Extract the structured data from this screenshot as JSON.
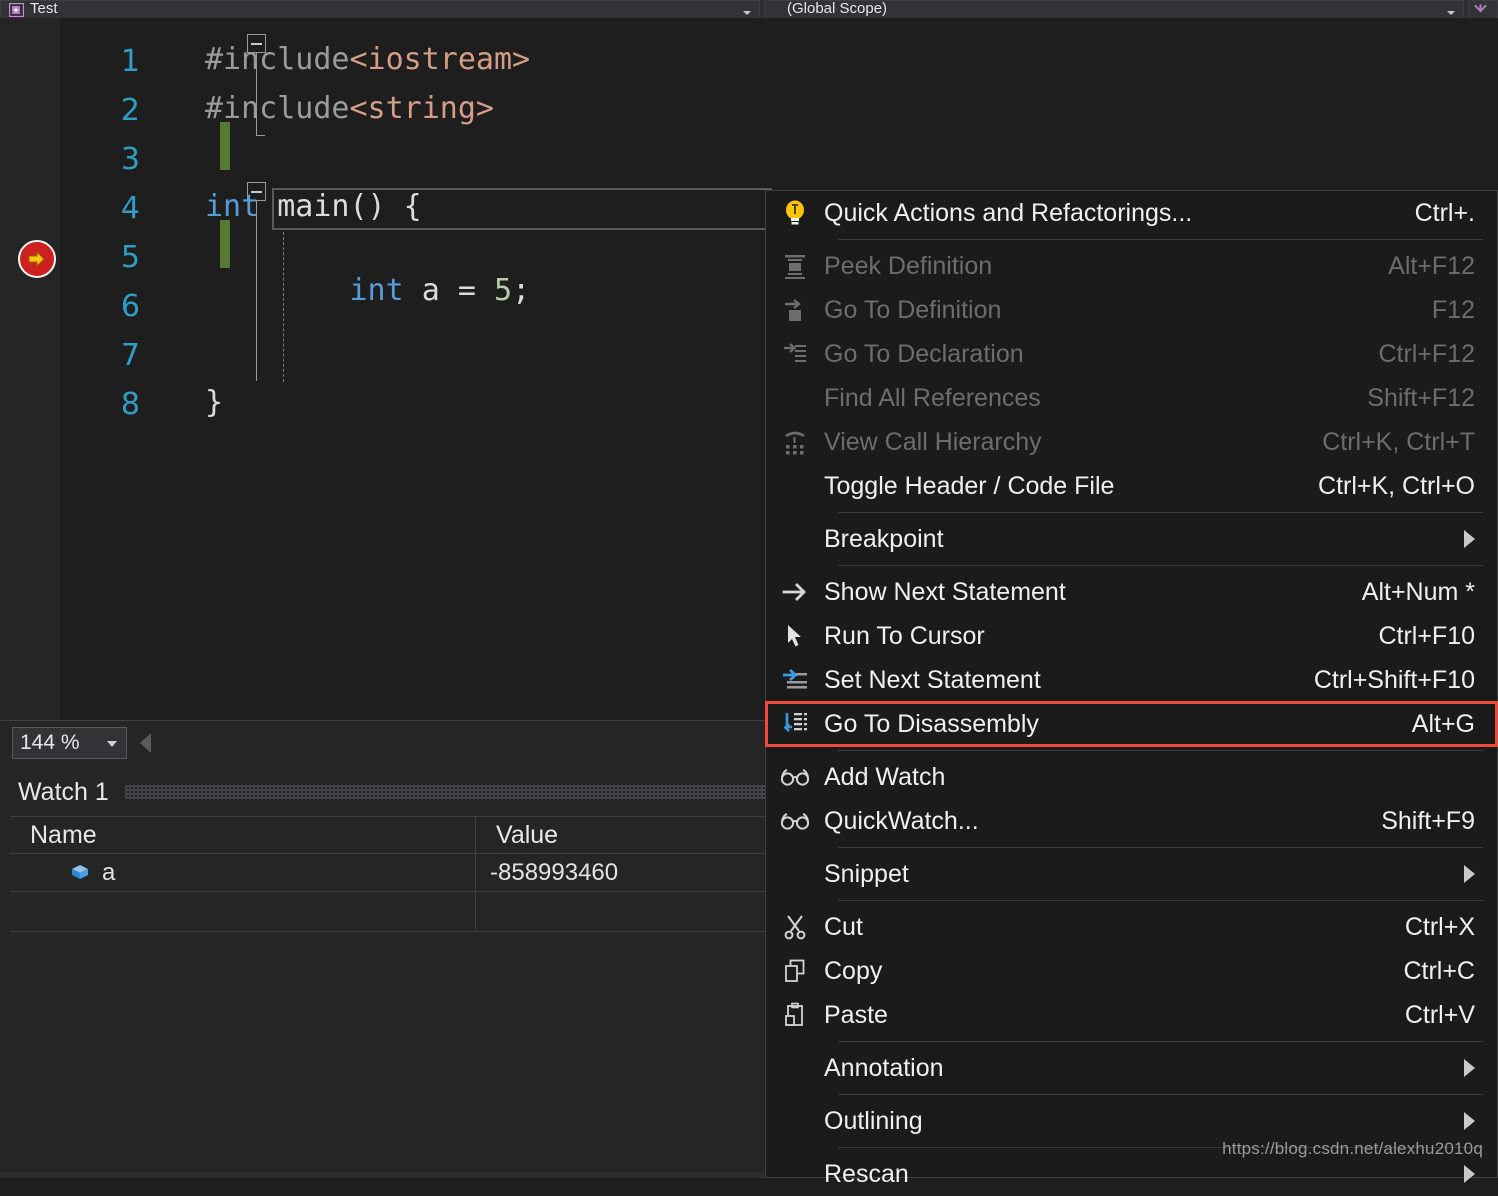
{
  "topbar": {
    "file_tab": "Test",
    "file_tab_icon": "file-cpp-icon",
    "scope": "(Global Scope)",
    "right_icon": "expand-icon"
  },
  "editor": {
    "lines": [
      {
        "number": "1",
        "text": "#include<iostream>"
      },
      {
        "number": "2",
        "text": "#include<string>"
      },
      {
        "number": "3",
        "text": ""
      },
      {
        "number": "4",
        "text": "int main() {"
      },
      {
        "number": "5",
        "text": "    int a = 5;"
      },
      {
        "number": "6",
        "text": ""
      },
      {
        "number": "7",
        "text": ""
      },
      {
        "number": "8",
        "text": "}"
      }
    ],
    "line1_hash": "#include",
    "line1_hdr": "<iostream>",
    "line2_hash": "#include",
    "line2_hdr": "<string>",
    "line4_kw": "int",
    "line4_rest": " main() {",
    "line5_indent": "    ",
    "line5_kw": "int",
    "line5_mid": " a = ",
    "line5_num": "5",
    "line5_end": ";",
    "line8_text": "}",
    "exec_marker": "current-statement-arrow-icon",
    "colors": {
      "line_number": "#2f9ec4",
      "keyword": "#569cd6",
      "preprocessor": "#9b9b9b",
      "header_string": "#d69d85",
      "number_literal": "#b5cea8",
      "change_bar": "#577a33",
      "background": "#1e1e1e"
    }
  },
  "zoombar": {
    "zoom_level": "144 %"
  },
  "watch": {
    "title": "Watch 1",
    "columns": [
      "Name",
      "Value"
    ],
    "rows": [
      {
        "icon": "variable-cube-icon",
        "name": "a",
        "value": "-858993460"
      },
      {
        "icon": "",
        "name": "",
        "value": ""
      }
    ]
  },
  "context_menu": {
    "items": [
      {
        "icon": "lightbulb-icon",
        "label": "Quick Actions and Refactorings...",
        "shortcut": "Ctrl+.",
        "disabled": false,
        "submenu": false,
        "separator_after": true,
        "highlight": false
      },
      {
        "icon": "peek-definition-icon",
        "label": "Peek Definition",
        "shortcut": "Alt+F12",
        "disabled": true,
        "submenu": false,
        "separator_after": false,
        "highlight": false
      },
      {
        "icon": "go-to-definition-icon",
        "label": "Go To Definition",
        "shortcut": "F12",
        "disabled": true,
        "submenu": false,
        "separator_after": false,
        "highlight": false
      },
      {
        "icon": "go-to-declaration-icon",
        "label": "Go To Declaration",
        "shortcut": "Ctrl+F12",
        "disabled": true,
        "submenu": false,
        "separator_after": false,
        "highlight": false
      },
      {
        "icon": "",
        "label": "Find All References",
        "shortcut": "Shift+F12",
        "disabled": true,
        "submenu": false,
        "separator_after": false,
        "highlight": false
      },
      {
        "icon": "call-hierarchy-icon",
        "label": "View Call Hierarchy",
        "shortcut": "Ctrl+K, Ctrl+T",
        "disabled": true,
        "submenu": false,
        "separator_after": false,
        "highlight": false
      },
      {
        "icon": "",
        "label": "Toggle Header / Code File",
        "shortcut": "Ctrl+K, Ctrl+O",
        "disabled": false,
        "submenu": false,
        "separator_after": true,
        "highlight": false
      },
      {
        "icon": "",
        "label": "Breakpoint",
        "shortcut": "",
        "disabled": false,
        "submenu": true,
        "separator_after": true,
        "highlight": false
      },
      {
        "icon": "arrow-right-icon",
        "label": "Show Next Statement",
        "shortcut": "Alt+Num *",
        "disabled": false,
        "submenu": false,
        "separator_after": false,
        "highlight": false
      },
      {
        "icon": "cursor-pointer-icon",
        "label": "Run To Cursor",
        "shortcut": "Ctrl+F10",
        "disabled": false,
        "submenu": false,
        "separator_after": false,
        "highlight": false
      },
      {
        "icon": "set-next-statement-icon",
        "label": "Set Next Statement",
        "shortcut": "Ctrl+Shift+F10",
        "disabled": false,
        "submenu": false,
        "separator_after": false,
        "highlight": false
      },
      {
        "icon": "disassembly-icon",
        "label": "Go To Disassembly",
        "shortcut": "Alt+G",
        "disabled": false,
        "submenu": false,
        "separator_after": true,
        "highlight": true
      },
      {
        "icon": "glasses-icon",
        "label": "Add Watch",
        "shortcut": "",
        "disabled": false,
        "submenu": false,
        "separator_after": false,
        "highlight": false
      },
      {
        "icon": "glasses-icon",
        "label": "QuickWatch...",
        "shortcut": "Shift+F9",
        "disabled": false,
        "submenu": false,
        "separator_after": true,
        "highlight": false
      },
      {
        "icon": "",
        "label": "Snippet",
        "shortcut": "",
        "disabled": false,
        "submenu": true,
        "separator_after": true,
        "highlight": false
      },
      {
        "icon": "scissors-icon",
        "label": "Cut",
        "shortcut": "Ctrl+X",
        "disabled": false,
        "submenu": false,
        "separator_after": false,
        "highlight": false
      },
      {
        "icon": "copy-icon",
        "label": "Copy",
        "shortcut": "Ctrl+C",
        "disabled": false,
        "submenu": false,
        "separator_after": false,
        "highlight": false
      },
      {
        "icon": "paste-icon",
        "label": "Paste",
        "shortcut": "Ctrl+V",
        "disabled": false,
        "submenu": false,
        "separator_after": true,
        "highlight": false
      },
      {
        "icon": "",
        "label": "Annotation",
        "shortcut": "",
        "disabled": false,
        "submenu": true,
        "separator_after": true,
        "highlight": false
      },
      {
        "icon": "",
        "label": "Outlining",
        "shortcut": "",
        "disabled": false,
        "submenu": true,
        "separator_after": true,
        "highlight": false
      },
      {
        "icon": "",
        "label": "Rescan",
        "shortcut": "",
        "disabled": false,
        "submenu": true,
        "separator_after": false,
        "highlight": false
      }
    ],
    "highlight_color": "#f04a3f"
  },
  "watermark": "https://blog.csdn.net/alexhu2010q"
}
